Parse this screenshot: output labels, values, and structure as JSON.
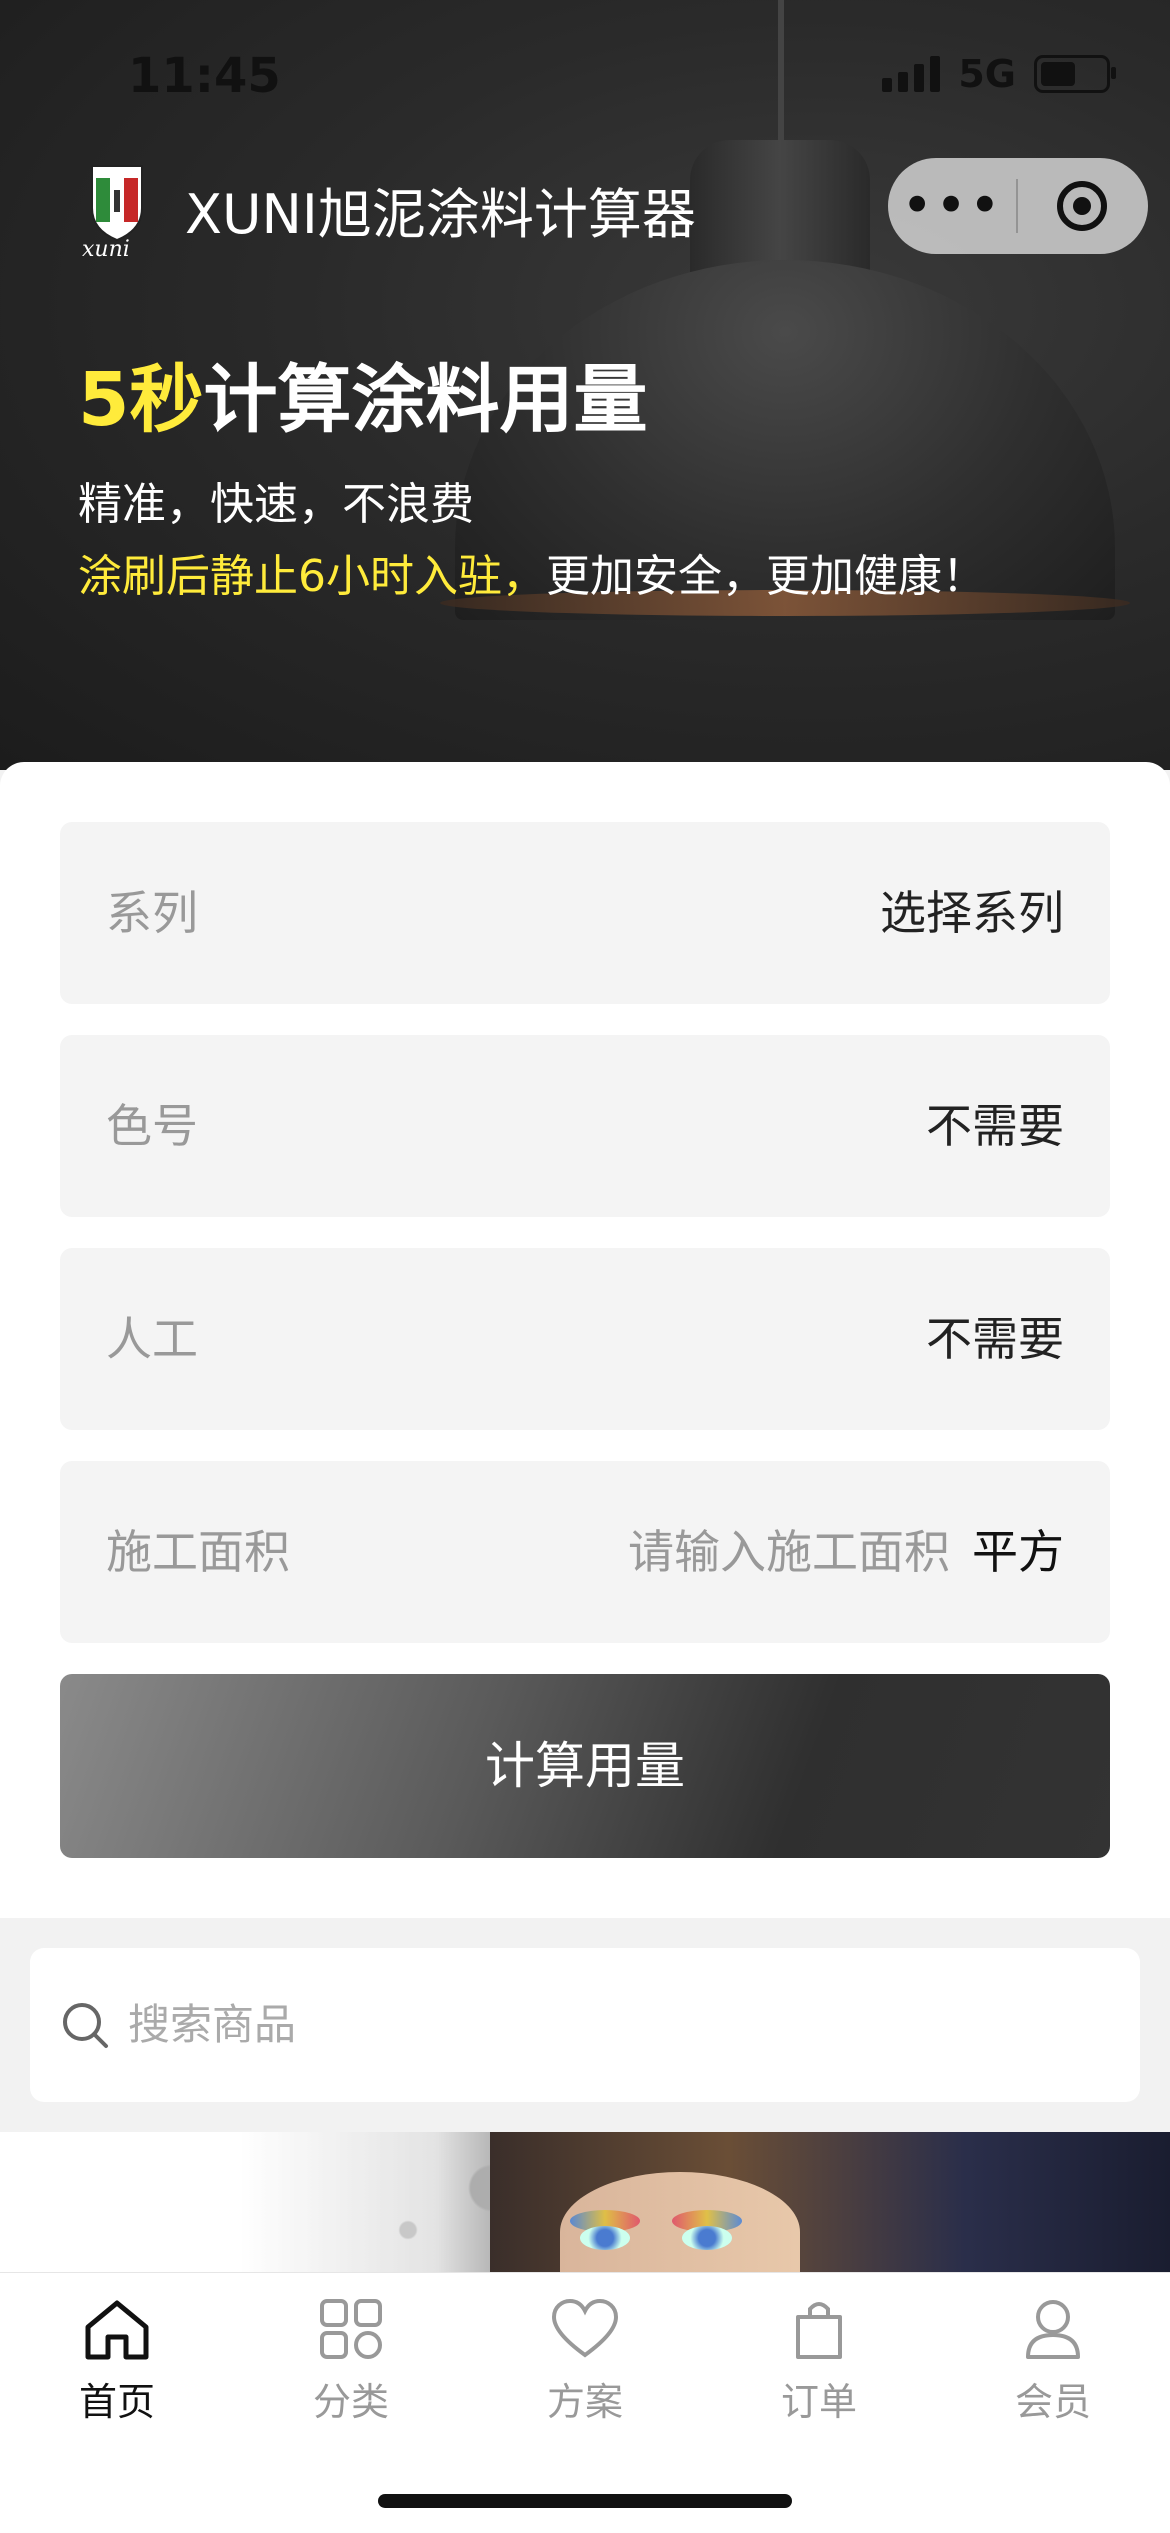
{
  "status_bar": {
    "time": "11:45",
    "network": "5G"
  },
  "header": {
    "app_title": "XUNI旭泥涂料计算器",
    "more_label": "•••"
  },
  "hero": {
    "headline_highlight": "5秒",
    "headline_rest": "计算涂料用量",
    "subtitle_line1": "精准，快速，不浪费",
    "subtitle_line2_highlight": "涂刷后静止6小时入驻，",
    "subtitle_line2_rest": "更加安全，更加健康！"
  },
  "form": {
    "series": {
      "label": "系列",
      "value": "选择系列"
    },
    "color": {
      "label": "色号",
      "value": "不需要"
    },
    "labor": {
      "label": "人工",
      "value": "不需要"
    },
    "area": {
      "label": "施工面积",
      "placeholder": "请输入施工面积",
      "unit": "平方"
    },
    "submit_label": "计算用量"
  },
  "search": {
    "placeholder": "搜索商品"
  },
  "tabbar": {
    "items": [
      {
        "label": "首页",
        "icon": "home-icon",
        "active": true
      },
      {
        "label": "分类",
        "icon": "grid-icon",
        "active": false
      },
      {
        "label": "方案",
        "icon": "heart-icon",
        "active": false
      },
      {
        "label": "订单",
        "icon": "bag-icon",
        "active": false
      },
      {
        "label": "会员",
        "icon": "user-icon",
        "active": false
      }
    ]
  },
  "colors": {
    "accent_yellow": "#ffeb3b",
    "active_tab": "#111111",
    "inactive_tab": "#999999"
  }
}
